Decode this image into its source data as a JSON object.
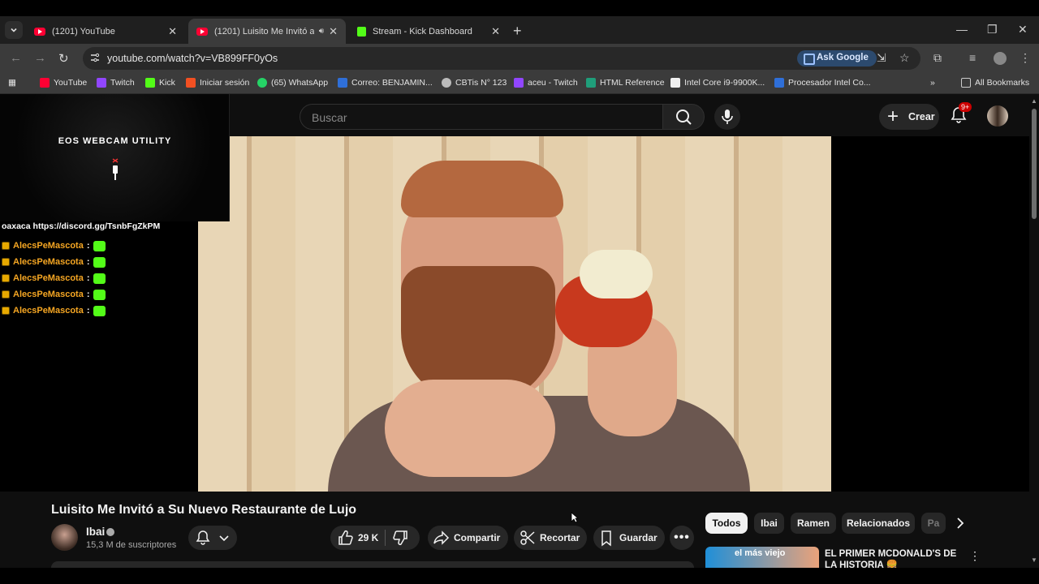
{
  "browser": {
    "tabs": [
      {
        "title": "(1201) YouTube",
        "active": false
      },
      {
        "title": "(1201) Luisito Me Invitó a Su Nuevo Restaurante de Lujo",
        "active": true
      },
      {
        "title": "Stream - Kick Dashboard",
        "active": false
      }
    ],
    "url": "youtube.com/watch?v=VB899FF0yOs",
    "ask_google": "Ask Google",
    "bookmarks": [
      {
        "label": "YouTube",
        "color": "#ff0033"
      },
      {
        "label": "Twitch",
        "color": "#9146ff"
      },
      {
        "label": "Kick",
        "color": "#53fc18"
      },
      {
        "label": "Iniciar sesión",
        "color": "#f25022"
      },
      {
        "label": "(65) WhatsApp",
        "color": "#25d366"
      },
      {
        "label": "Correo: BENJAMIN...",
        "color": "#2f6fd8"
      },
      {
        "label": "CBTis N° 123",
        "color": "#bbbbbb"
      },
      {
        "label": "aceu - Twitch",
        "color": "#9146ff"
      },
      {
        "label": "HTML Reference",
        "color": "#1f9e7a"
      },
      {
        "label": "Intel Core i9-9900K...",
        "color": "#f0f0f0"
      },
      {
        "label": "Procesador Intel Co...",
        "color": "#2f6fd8"
      }
    ],
    "all_bookmarks": "All Bookmarks"
  },
  "overlay": {
    "webcam_title": "EOS WEBCAM UTILITY",
    "chat_top": "oaxaca https://discord.gg/TsnbFgZkPM",
    "chat_lines": [
      {
        "user": "AlecsPeMascota",
        "sep": ":"
      },
      {
        "user": "AlecsPeMascota",
        "sep": ":"
      },
      {
        "user": "AlecsPeMascota",
        "sep": ":"
      },
      {
        "user": "AlecsPeMascota",
        "sep": ":"
      },
      {
        "user": "AlecsPeMascota",
        "sep": ":"
      }
    ]
  },
  "youtube": {
    "search_placeholder": "Buscar",
    "create": "Crear",
    "notif_badge": "9+",
    "video_title": "Luisito Me Invitó a Su Nuevo Restaurante de Lujo",
    "channel": {
      "name": "Ibai",
      "subs": "15,3 M de suscriptores"
    },
    "actions": {
      "likes": "29 K",
      "share": "Compartir",
      "clip": "Recortar",
      "save": "Guardar"
    },
    "chips": [
      "Todos",
      "Ibai",
      "Ramen",
      "Relacionados",
      "Pa"
    ],
    "rec": {
      "thumb_text": "el más viejo",
      "title": "EL PRIMER MCDONALD'S DE LA HISTORIA 🍔"
    }
  }
}
